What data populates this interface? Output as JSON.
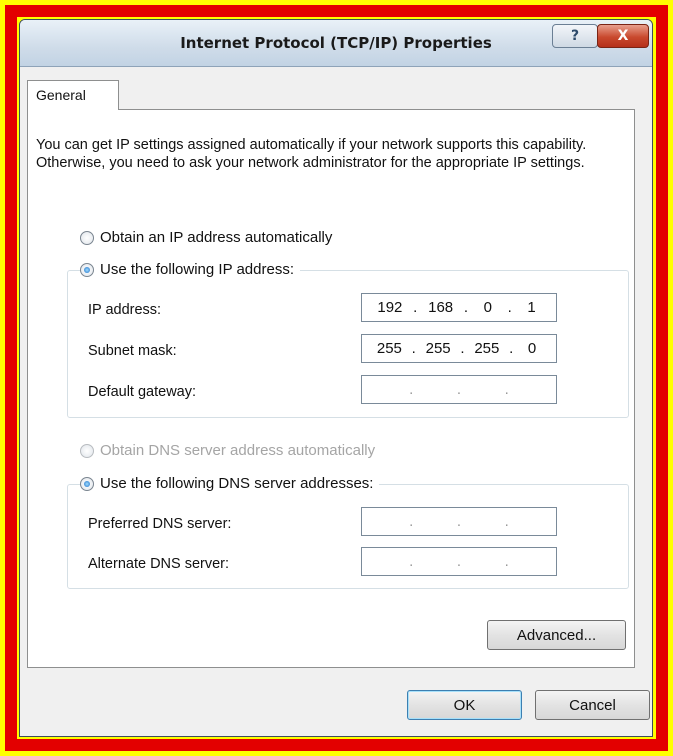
{
  "window": {
    "title": "Internet Protocol (TCP/IP) Properties",
    "help_glyph": "?",
    "close_glyph": "X"
  },
  "tabs": [
    {
      "label": "General"
    }
  ],
  "intro_text": "You can get IP settings assigned automatically if your network supports this capability. Otherwise, you need to ask your network administrator for the appropriate IP settings.",
  "ip": {
    "auto_label": "Obtain an IP address automatically",
    "auto_selected": false,
    "manual_label": "Use the following IP address:",
    "manual_selected": true,
    "fields": [
      {
        "label": "IP address:",
        "octets": [
          "192",
          "168",
          "0",
          "1"
        ]
      },
      {
        "label": "Subnet mask:",
        "octets": [
          "255",
          "255",
          "255",
          "0"
        ]
      },
      {
        "label": "Default gateway:",
        "octets": [
          "",
          "",
          "",
          ""
        ]
      }
    ]
  },
  "dns": {
    "auto_label": "Obtain DNS server address automatically",
    "auto_enabled": false,
    "manual_label": "Use the following DNS server addresses:",
    "manual_selected": true,
    "fields": [
      {
        "label": "Preferred DNS server:",
        "octets": [
          "",
          "",
          "",
          ""
        ]
      },
      {
        "label": "Alternate DNS server:",
        "octets": [
          "",
          "",
          "",
          ""
        ]
      }
    ]
  },
  "buttons": {
    "advanced": "Advanced...",
    "ok": "OK",
    "cancel": "Cancel"
  },
  "colors": {
    "outer_frame": "#ffff00",
    "inner_frame": "#e30000",
    "close_button": "#c9492e"
  }
}
